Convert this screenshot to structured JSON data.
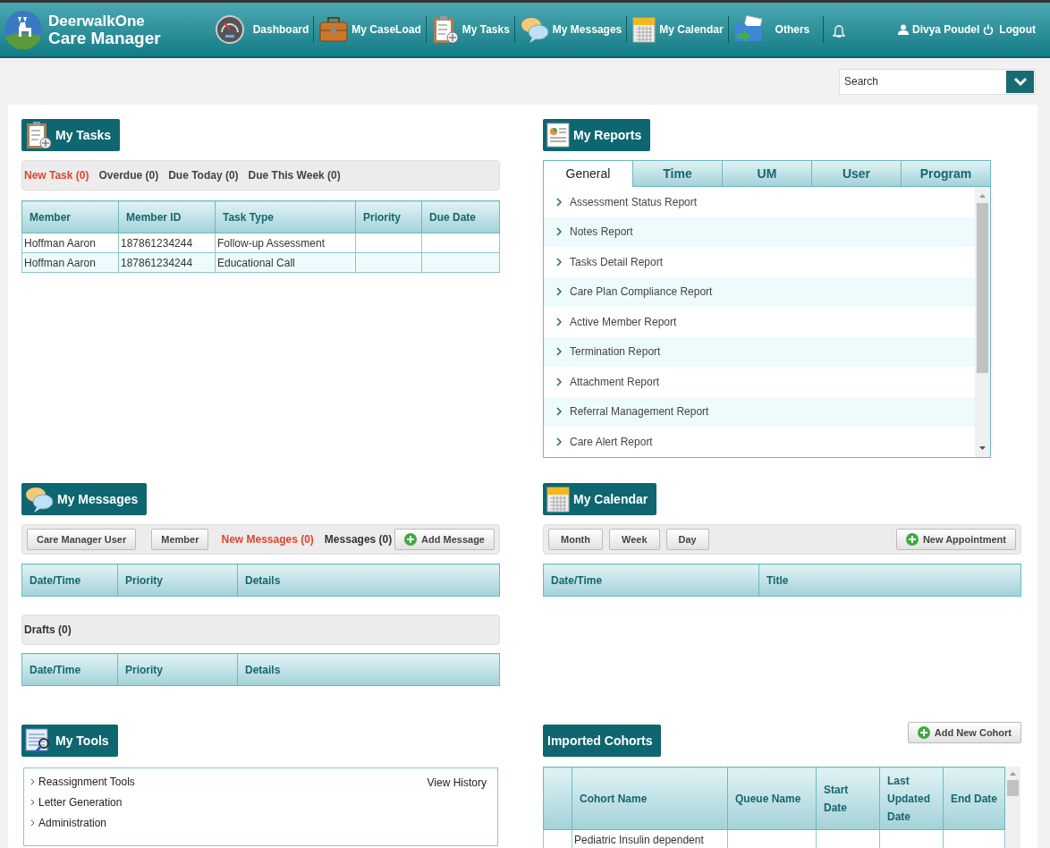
{
  "header": {
    "logo_line1": "DeerwalkOne",
    "logo_line2": "Care Manager",
    "nav": [
      {
        "label": "Dashboard",
        "kind": "gauge"
      },
      {
        "label": "My CaseLoad",
        "kind": "briefcase"
      },
      {
        "label": "My Tasks",
        "kind": "clipboard"
      },
      {
        "label": "My Messages",
        "kind": "chat"
      },
      {
        "label": "My Calendar",
        "kind": "calendar"
      },
      {
        "label": "Others",
        "kind": "folder"
      }
    ],
    "user": "Divya Poudel",
    "logout": "Logout"
  },
  "search": {
    "placeholder": "Search"
  },
  "tasks": {
    "title": "My Tasks",
    "filters": [
      {
        "label": "New Task (0)",
        "selected": true
      },
      {
        "label": "Overdue (0)",
        "selected": false
      },
      {
        "label": "Due Today (0)",
        "selected": false
      },
      {
        "label": "Due This Week (0)",
        "selected": false
      }
    ],
    "columns": [
      "Member",
      "Member ID",
      "Task Type",
      "Priority",
      "Due Date"
    ],
    "rows": [
      [
        "Hoffman Aaron",
        "187861234244",
        "Follow-up Assessment",
        "",
        ""
      ],
      [
        "Hoffman Aaron",
        "187861234244",
        "Educational Call",
        "",
        ""
      ]
    ]
  },
  "reports": {
    "title": "My Reports",
    "tabs": [
      {
        "label": "General",
        "selected": true
      },
      {
        "label": "Time",
        "selected": false
      },
      {
        "label": "UM",
        "selected": false
      },
      {
        "label": "User",
        "selected": false
      },
      {
        "label": "Program",
        "selected": false
      }
    ],
    "items": [
      "Assessment Status Report",
      "Notes Report",
      "Tasks Detail Report",
      "Care Plan Compliance Report",
      "Active Member Report",
      "Termination Report",
      "Attachment Report",
      "Referral Management Report",
      "Care Alert Report"
    ]
  },
  "messages": {
    "title": "My Messages",
    "buttons": [
      "Care Manager User",
      "Member"
    ],
    "filters": [
      {
        "label": "New Messages (0)",
        "selected": true
      },
      {
        "label": "Messages (0)",
        "selected": false
      }
    ],
    "add_button": "Add Message",
    "columns": [
      "Date/Time",
      "Priority",
      "Details"
    ],
    "drafts": {
      "label": "Drafts (0)",
      "columns": [
        "Date/Time",
        "Priority",
        "Details"
      ]
    }
  },
  "calendar": {
    "title": "My Calendar",
    "views": [
      "Month",
      "Week",
      "Day"
    ],
    "new_button": "New Appointment",
    "columns": [
      "Date/Time",
      "Title"
    ]
  },
  "tools": {
    "title": "My Tools",
    "items": [
      "Reassignment Tools",
      "Letter Generation",
      "Administration"
    ],
    "view_history": "View History"
  },
  "cohorts": {
    "title": "Imported Cohorts",
    "add_button": "Add New Cohort",
    "columns": [
      "",
      "Cohort Name",
      "Queue Name",
      "Start Date",
      "Last Updated Date",
      "End Date"
    ],
    "rows": [
      [
        "",
        "Pediatric Insulin dependent",
        "",
        "",
        "",
        ""
      ]
    ]
  }
}
